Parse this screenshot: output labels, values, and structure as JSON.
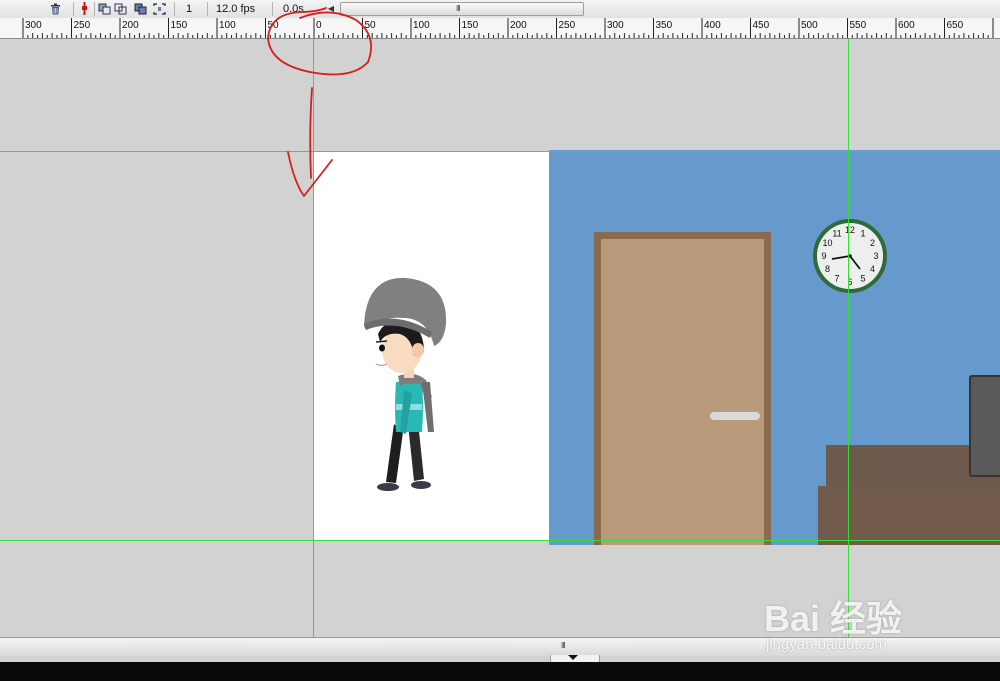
{
  "toolbar": {
    "icons": [
      "trash-icon",
      "onion-skin-marker-icon",
      "onion-skin-icon",
      "onion-skin-outlines-icon",
      "edit-multiple-frames-icon",
      "modify-markers-icon"
    ],
    "current_frame": "1",
    "frame_rate": "12.0 fps",
    "elapsed_time": "0.0s",
    "scroll_grip": "III"
  },
  "ruler": {
    "labels": [
      "300",
      "250",
      "200",
      "150",
      "100",
      "50",
      "0",
      "50",
      "100",
      "150",
      "200",
      "250",
      "300",
      "350",
      "400",
      "450",
      "500",
      "550",
      "600",
      "650"
    ]
  },
  "stage": {
    "stage_color": "#ffffff",
    "scene_color": "#6699cc",
    "guide_color": "#33dd33"
  },
  "clock": {
    "numerals": [
      "12",
      "1",
      "2",
      "3",
      "4",
      "5",
      "6",
      "7",
      "8",
      "9",
      "10",
      "11"
    ]
  },
  "annotation": {
    "color": "#d42020"
  },
  "bottom": {
    "scroll_grip": "III"
  },
  "watermark": {
    "logo": "Bai 经验",
    "url": "jingyan.baidu.com"
  }
}
